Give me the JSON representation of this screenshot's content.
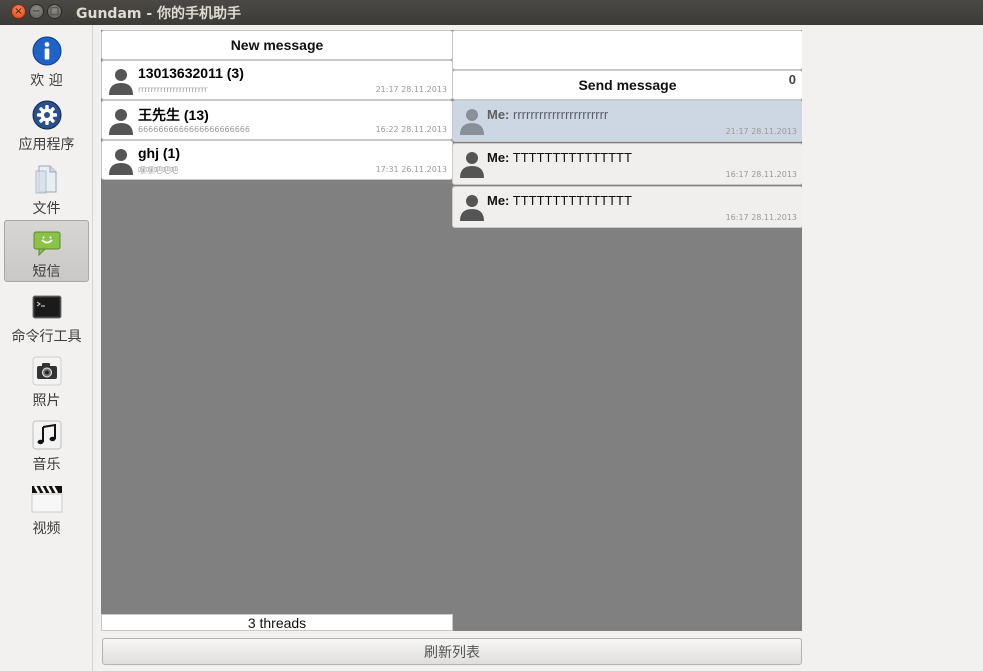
{
  "window": {
    "title": "Gundam - 你的手机助手",
    "close_glyph": "×",
    "min_glyph": "−",
    "max_glyph": "□"
  },
  "sidebar": {
    "items": [
      {
        "label": "欢 迎",
        "icon": "info-icon"
      },
      {
        "label": "应用程序",
        "icon": "gear-icon"
      },
      {
        "label": "文件",
        "icon": "file-icon"
      },
      {
        "label": "短信",
        "icon": "message-icon",
        "active": true
      },
      {
        "label": "命令行工具",
        "icon": "terminal-icon"
      },
      {
        "label": "照片",
        "icon": "camera-icon"
      },
      {
        "label": "音乐",
        "icon": "music-icon"
      },
      {
        "label": "视频",
        "icon": "clapperboard-icon"
      }
    ]
  },
  "threads": {
    "new_message_label": "New message",
    "items": [
      {
        "name": "13013632011 (3)",
        "preview": "rrrrrrrrrrrrrrrrrrrrrr",
        "time": "21:17 28.11.2013"
      },
      {
        "name": "王先生 (13)",
        "preview": "6666666666666666666666",
        "time": "16:22 28.11.2013"
      },
      {
        "name": "ghj (1)",
        "preview": "嘿嘿吧吧吧",
        "time": "17:31 26.11.2013"
      }
    ],
    "count_label": "3 threads"
  },
  "conversation": {
    "send_label": "Send message",
    "char_count": "0",
    "messages": [
      {
        "sender": "Me:",
        "text": "rrrrrrrrrrrrrrrrrrrrrr",
        "time": "21:17 28.11.2013",
        "selected": true
      },
      {
        "sender": "Me:",
        "text": "TTTTTTTTTTTTTTT",
        "time": "16:17 28.11.2013",
        "selected": false
      },
      {
        "sender": "Me:",
        "text": "TTTTTTTTTTTTTTT",
        "time": "16:17 28.11.2013",
        "selected": false
      }
    ]
  },
  "footer": {
    "refresh_label": "刷新列表"
  },
  "colors": {
    "accent_close": "#dd4814",
    "content_bg": "#808080",
    "selected_msg": "#cdd7e3",
    "titlebar": "#3c3b37"
  }
}
